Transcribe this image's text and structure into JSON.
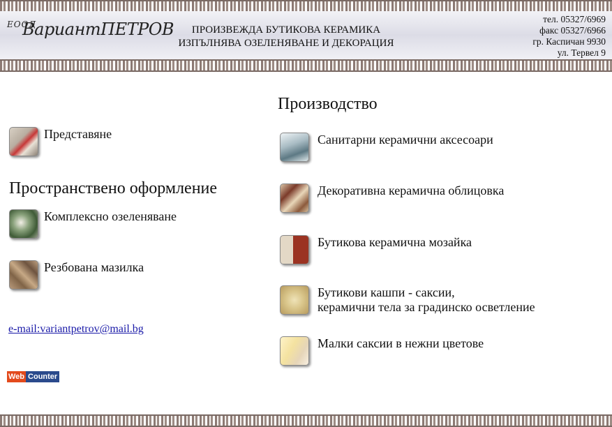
{
  "header": {
    "logo_small": "ЕООД",
    "logo_big": "ВариантПЕТРОВ",
    "tagline_line1": "ПРОИЗВЕЖДА БУТИКОВА КЕРАМИКА",
    "tagline_line2": "ИЗПЪЛНЯВА ОЗЕЛЕНЯВАНЕ И ДЕКОРАЦИЯ",
    "phone": "тел. 05327/6969",
    "fax": "факс 05327/6966",
    "city": "гр. Каспичан 9930",
    "street": "ул. Тервел 9"
  },
  "left": {
    "present_label": "Представяне",
    "section_title": "Пространствено оформление",
    "items": [
      {
        "label": "Комплексно озеленяване",
        "icon": "greenery-icon"
      },
      {
        "label": "Резбована мазилка",
        "icon": "carved-plaster-icon"
      }
    ],
    "email": "e-mail:variantpetrov@mail.bg",
    "counter_left": "Web",
    "counter_right": "Counter"
  },
  "right": {
    "section_title": "Производство",
    "items": [
      {
        "line1": "Санитарни керамични аксесоари",
        "line2": ""
      },
      {
        "line1": "Декоративна керамична облицовка",
        "line2": ""
      },
      {
        "line1": "Бутикова керамична мозайка",
        "line2": ""
      },
      {
        "line1": "Бутикови кашпи - саксии,",
        "line2": "керамични тела за градинско осветление"
      },
      {
        "line1": "Малки саксии в нежни цветове",
        "line2": ""
      }
    ]
  }
}
